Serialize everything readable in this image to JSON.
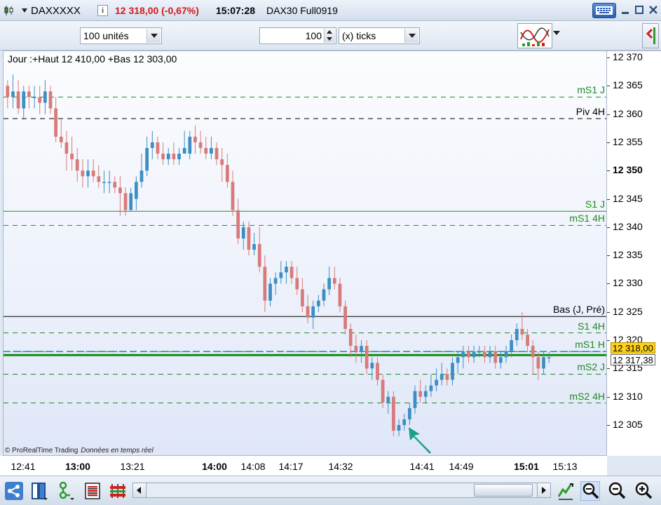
{
  "titlebar": {
    "instrument": "DAXXXXX",
    "price_change": "12 318,00 (-0,67%)",
    "time": "15:07:28",
    "contract": "DAX30 Full0919",
    "icons": [
      "candlestick-logo-icon",
      "dropdown-arrow-icon",
      "info-icon",
      "keyboard-icon",
      "minimize-icon",
      "maximize-icon",
      "close-icon"
    ]
  },
  "toolbar": {
    "units_value": "100 unités",
    "ticks_value": "100",
    "ticks_unit": "(x) ticks",
    "icons": [
      "indicators-icon",
      "collapse-panel-icon"
    ]
  },
  "chart": {
    "legend": "Jour :+Haut 12 410,00 +Bas 12 303,00",
    "copyright": "© ProRealTime Trading",
    "realtime": "Données en temps réel",
    "last_price_tag": "12 318,00",
    "cursor_price_tag": "12 317,38",
    "levels": [
      {
        "label": "mS1 J",
        "price": 12363,
        "color": "#1e8b1e",
        "style": "dashed"
      },
      {
        "label": "Piv 4H",
        "price": 12359.2,
        "color": "#000000",
        "style": "dashed"
      },
      {
        "label": "S1 J",
        "price": 12342.8,
        "color": "#1e8b1e",
        "style": "solid"
      },
      {
        "label": "mS1 4H",
        "price": 12340.3,
        "color": "#1e8b1e",
        "style": "dashed"
      },
      {
        "label": "Bas (J, Pré)",
        "price": 12324.2,
        "color": "#000000",
        "style": "solid"
      },
      {
        "label": "S1 4H",
        "price": 12321.3,
        "color": "#1e8b1e",
        "style": "dashed"
      },
      {
        "label": "mS1 H",
        "price": 12318,
        "color": "#1e8b1e",
        "style": "dashed"
      },
      {
        "label": "mS2 J",
        "price": 12314,
        "color": "#1e8b1e",
        "style": "dashed"
      },
      {
        "label": "mS2 4H",
        "price": 12308.9,
        "color": "#1e8b1e",
        "style": "dashed"
      }
    ],
    "last_price_line": 12318,
    "current_price_line": 12317.38
  },
  "price_axis": {
    "ticks": [
      {
        "label": "12 370",
        "value": 12370,
        "bold": false
      },
      {
        "label": "12 365",
        "value": 12365,
        "bold": false
      },
      {
        "label": "12 360",
        "value": 12360,
        "bold": false
      },
      {
        "label": "12 355",
        "value": 12355,
        "bold": false
      },
      {
        "label": "12 350",
        "value": 12350,
        "bold": true
      },
      {
        "label": "12 345",
        "value": 12345,
        "bold": false
      },
      {
        "label": "12 340",
        "value": 12340,
        "bold": false
      },
      {
        "label": "12 335",
        "value": 12335,
        "bold": false
      },
      {
        "label": "12 330",
        "value": 12330,
        "bold": false
      },
      {
        "label": "12 325",
        "value": 12325,
        "bold": false
      },
      {
        "label": "12 320",
        "value": 12320,
        "bold": false
      },
      {
        "label": "12 315",
        "value": 12315,
        "bold": false
      },
      {
        "label": "12 310",
        "value": 12310,
        "bold": false
      },
      {
        "label": "12 305",
        "value": 12305,
        "bold": false
      }
    ]
  },
  "time_axis": {
    "ticks": [
      {
        "label": "12:41",
        "bold": false
      },
      {
        "label": "13:00",
        "bold": true
      },
      {
        "label": "13:21",
        "bold": false
      },
      {
        "label": "14:00",
        "bold": true
      },
      {
        "label": "14:08",
        "bold": false
      },
      {
        "label": "14:17",
        "bold": false
      },
      {
        "label": "14:32",
        "bold": false
      },
      {
        "label": "14:41",
        "bold": false
      },
      {
        "label": "14:49",
        "bold": false
      },
      {
        "label": "15:01",
        "bold": true
      },
      {
        "label": "15:13",
        "bold": false
      }
    ]
  },
  "bottombar": {
    "icons": [
      "share-icon",
      "layout-icon",
      "indicator-tree-icon",
      "list-icon",
      "bars-icon",
      "scroll-left-icon",
      "scroll-right-icon",
      "auto-scale-icon",
      "zoom-fit-icon",
      "zoom-out-icon",
      "zoom-in-icon"
    ]
  },
  "chart_data": {
    "type": "candlestick",
    "y_range": [
      12301,
      12372
    ],
    "colors": {
      "up": "#3c8fc4",
      "down": "#d87a7a"
    },
    "candles": [
      [
        12365,
        12366,
        12361,
        12363
      ],
      [
        12363,
        12367,
        12361,
        12364
      ],
      [
        12364,
        12366,
        12360,
        12361
      ],
      [
        12361,
        12365,
        12359,
        12364
      ],
      [
        12364,
        12365,
        12361,
        12363
      ],
      [
        12363,
        12365,
        12361,
        12363
      ],
      [
        12363,
        12365,
        12360,
        12362
      ],
      [
        12362,
        12366,
        12360,
        12364
      ],
      [
        12364,
        12365,
        12360,
        12361
      ],
      [
        12361,
        12363,
        12355,
        12356
      ],
      [
        12356,
        12359,
        12354,
        12355
      ],
      [
        12355,
        12357,
        12350,
        12353
      ],
      [
        12353,
        12356,
        12350,
        12352
      ],
      [
        12352,
        12354,
        12348,
        12350
      ],
      [
        12350,
        12352,
        12347,
        12349
      ],
      [
        12349,
        12352,
        12347,
        12350
      ],
      [
        12350,
        12352,
        12348,
        12349
      ],
      [
        12349,
        12351,
        12347,
        12348
      ],
      [
        12348,
        12350,
        12346,
        12348
      ],
      [
        12348,
        12350,
        12346,
        12348
      ],
      [
        12348,
        12349,
        12346,
        12347
      ],
      [
        12347,
        12349,
        12342,
        12346
      ],
      [
        12346,
        12347,
        12342,
        12343
      ],
      [
        12343,
        12347,
        12343,
        12346
      ],
      [
        12345,
        12349,
        12343,
        12348
      ],
      [
        12348,
        12353,
        12347,
        12350
      ],
      [
        12350,
        12356,
        12349,
        12354
      ],
      [
        12354,
        12357,
        12352,
        12355
      ],
      [
        12355,
        12356,
        12352,
        12353
      ],
      [
        12353,
        12355,
        12351,
        12352
      ],
      [
        12352,
        12354,
        12351,
        12353
      ],
      [
        12353,
        12355,
        12351,
        12352
      ],
      [
        12352,
        12354,
        12351,
        12353
      ],
      [
        12353,
        12357,
        12353,
        12354
      ],
      [
        12353,
        12357,
        12352,
        12356
      ],
      [
        12356,
        12358,
        12353,
        12355
      ],
      [
        12355,
        12357,
        12353,
        12354
      ],
      [
        12354,
        12356,
        12352,
        12353
      ],
      [
        12353,
        12356,
        12352,
        12354
      ],
      [
        12354,
        12355,
        12351,
        12352
      ],
      [
        12352,
        12354,
        12348,
        12351
      ],
      [
        12351,
        12353,
        12347,
        12348
      ],
      [
        12348,
        12350,
        12342,
        12343
      ],
      [
        12343,
        12345,
        12337,
        12338
      ],
      [
        12338,
        12341,
        12336,
        12340
      ],
      [
        12340,
        12341,
        12335,
        12336
      ],
      [
        12336,
        12339,
        12335,
        12337
      ],
      [
        12337,
        12340,
        12332,
        12333
      ],
      [
        12333,
        12335,
        12325,
        12327
      ],
      [
        12327,
        12331,
        12326,
        12330
      ],
      [
        12330,
        12332,
        12328,
        12331
      ],
      [
        12331,
        12334,
        12330,
        12332
      ],
      [
        12332,
        12334,
        12330,
        12333
      ],
      [
        12333,
        12334,
        12330,
        12331
      ],
      [
        12331,
        12333,
        12328,
        12329
      ],
      [
        12329,
        12331,
        12325,
        12326
      ],
      [
        12326,
        12328,
        12323,
        12324
      ],
      [
        12324,
        12327,
        12322,
        12326
      ],
      [
        12326,
        12328,
        12325,
        12327
      ],
      [
        12327,
        12330,
        12326,
        12329
      ],
      [
        12329,
        12333,
        12328,
        12331
      ],
      [
        12331,
        12333,
        12329,
        12330
      ],
      [
        12330,
        12331,
        12325,
        12326
      ],
      [
        12326,
        12327,
        12321,
        12322
      ],
      [
        12322,
        12323,
        12317,
        12319
      ],
      [
        12319,
        12321,
        12316,
        12318
      ],
      [
        12318,
        12320,
        12316,
        12319
      ],
      [
        12319,
        12320,
        12314,
        12315
      ],
      [
        12315,
        12317,
        12313,
        12316
      ],
      [
        12316,
        12317,
        12312,
        12313
      ],
      [
        12313,
        12314,
        12308,
        12309
      ],
      [
        12309,
        12311,
        12307,
        12310
      ],
      [
        12310,
        12311,
        12303,
        12304
      ],
      [
        12304,
        12306,
        12303,
        12305
      ],
      [
        12305,
        12307,
        12304,
        12306
      ],
      [
        12306,
        12309,
        12305,
        12308
      ],
      [
        12308,
        12312,
        12307,
        12311
      ],
      [
        12311,
        12313,
        12309,
        12310
      ],
      [
        12310,
        12312,
        12309,
        12311
      ],
      [
        12311,
        12314,
        12310,
        12312
      ],
      [
        12312,
        12315,
        12311,
        12313
      ],
      [
        12313,
        12316,
        12312,
        12314
      ],
      [
        12314,
        12315,
        12312,
        12313
      ],
      [
        12313,
        12317,
        12312,
        12316
      ],
      [
        12316,
        12318,
        12314,
        12317
      ],
      [
        12317,
        12319,
        12315,
        12318
      ],
      [
        12318,
        12319,
        12316,
        12317
      ],
      [
        12317,
        12319,
        12316,
        12318
      ],
      [
        12318,
        12319,
        12317,
        12318
      ],
      [
        12318,
        12319,
        12316,
        12317
      ],
      [
        12317,
        12319,
        12316,
        12318
      ],
      [
        12318,
        12319,
        12315,
        12316
      ],
      [
        12316,
        12318,
        12315,
        12317
      ],
      [
        12317,
        12319,
        12316,
        12318
      ],
      [
        12318,
        12321,
        12317,
        12320
      ],
      [
        12320,
        12323,
        12319,
        12322
      ],
      [
        12322,
        12325,
        12320,
        12321
      ],
      [
        12321,
        12322,
        12318,
        12319
      ],
      [
        12319,
        12320,
        12314,
        12317
      ],
      [
        12317,
        12318,
        12313,
        12315
      ],
      [
        12315,
        12318,
        12314,
        12317
      ],
      [
        12317,
        12318,
        12316,
        12317
      ]
    ]
  }
}
